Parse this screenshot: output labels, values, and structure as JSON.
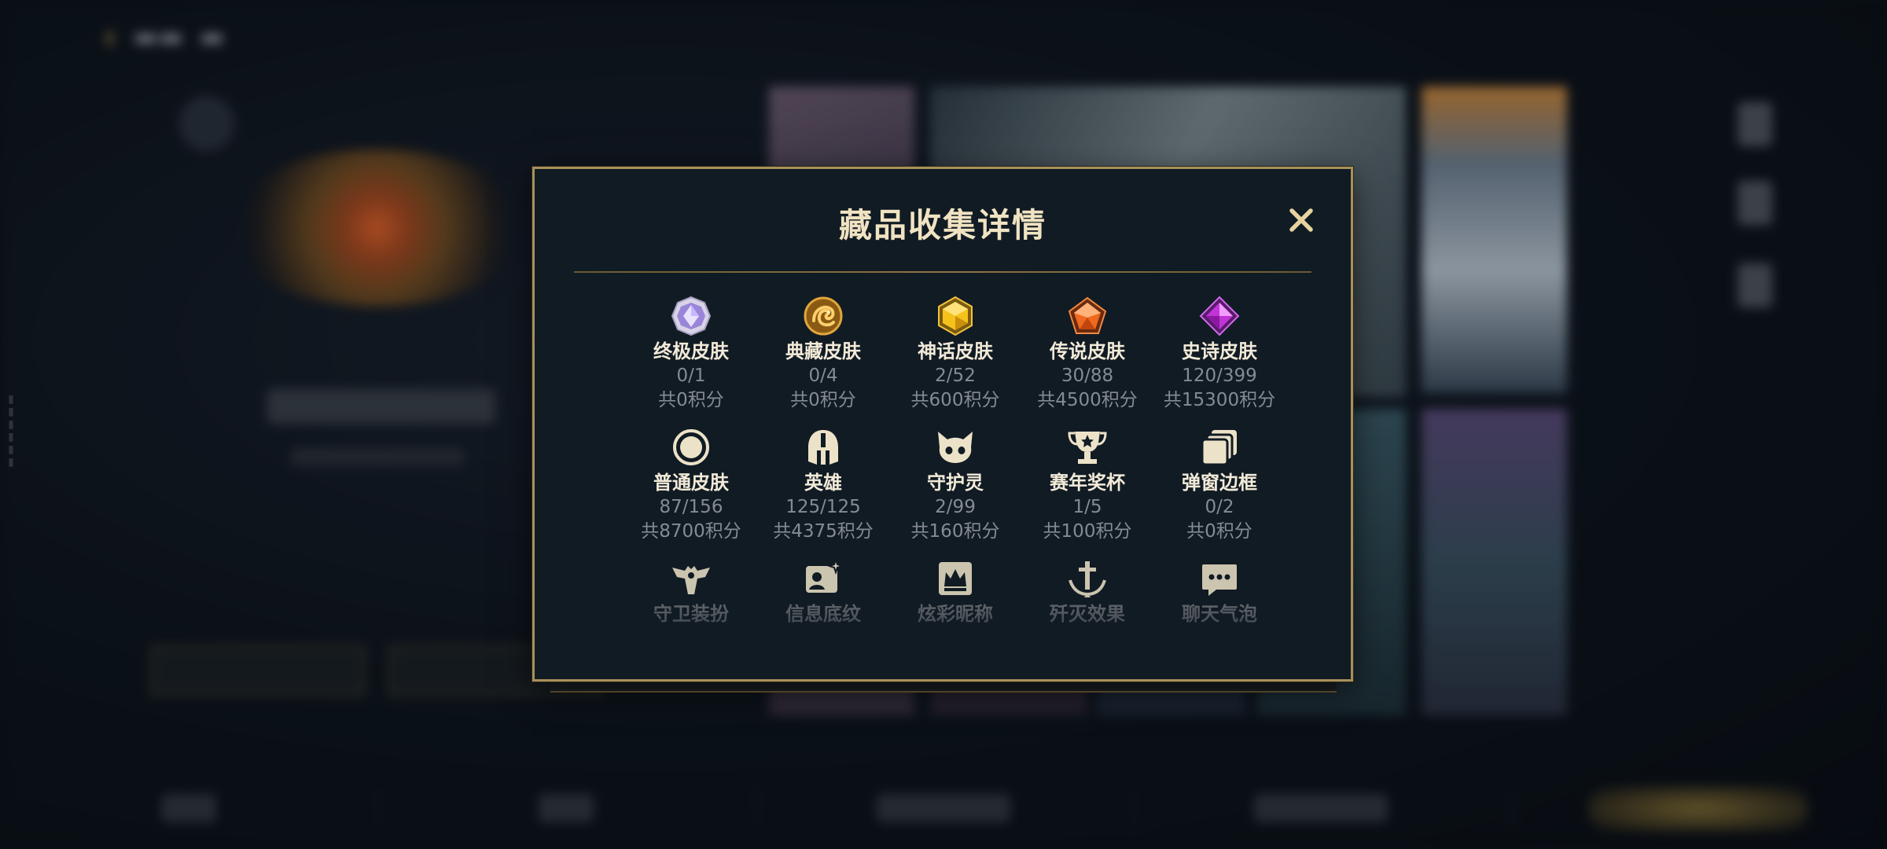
{
  "modal": {
    "title": "藏品收集详情",
    "close_icon": "close-icon"
  },
  "colors": {
    "accent_gold": "#a8915a",
    "title_text": "#f0e3c2",
    "modal_bg": "#111b24",
    "muted_text": "#858b92"
  },
  "items": [
    {
      "label": "终极皮肤",
      "count": "0/1",
      "points": "共0积分",
      "icon": "ultimate-skin-gem-icon"
    },
    {
      "label": "典藏皮肤",
      "count": "0/4",
      "points": "共0积分",
      "icon": "collector-skin-dragon-icon"
    },
    {
      "label": "神话皮肤",
      "count": "2/52",
      "points": "共600积分",
      "icon": "mythic-skin-gem-icon"
    },
    {
      "label": "传说皮肤",
      "count": "30/88",
      "points": "共4500积分",
      "icon": "legendary-skin-gem-icon"
    },
    {
      "label": "史诗皮肤",
      "count": "120/399",
      "points": "共15300积分",
      "icon": "epic-skin-gem-icon"
    },
    {
      "label": "普通皮肤",
      "count": "87/156",
      "points": "共8700积分",
      "icon": "common-skin-ring-icon"
    },
    {
      "label": "英雄",
      "count": "125/125",
      "points": "共4375积分",
      "icon": "hero-helmet-icon"
    },
    {
      "label": "守护灵",
      "count": "2/99",
      "points": "共160积分",
      "icon": "guardian-spirit-icon"
    },
    {
      "label": "赛年奖杯",
      "count": "1/5",
      "points": "共100积分",
      "icon": "season-trophy-icon"
    },
    {
      "label": "弹窗边框",
      "count": "0/2",
      "points": "共0积分",
      "icon": "popup-frame-icon"
    },
    {
      "label": "守卫装扮",
      "icon": "guard-outfit-icon"
    },
    {
      "label": "信息底纹",
      "icon": "info-background-icon"
    },
    {
      "label": "炫彩昵称",
      "icon": "colorful-nickname-icon"
    },
    {
      "label": "歼灭效果",
      "icon": "elimination-effect-icon"
    },
    {
      "label": "聊天气泡",
      "icon": "chat-bubble-icon"
    }
  ]
}
